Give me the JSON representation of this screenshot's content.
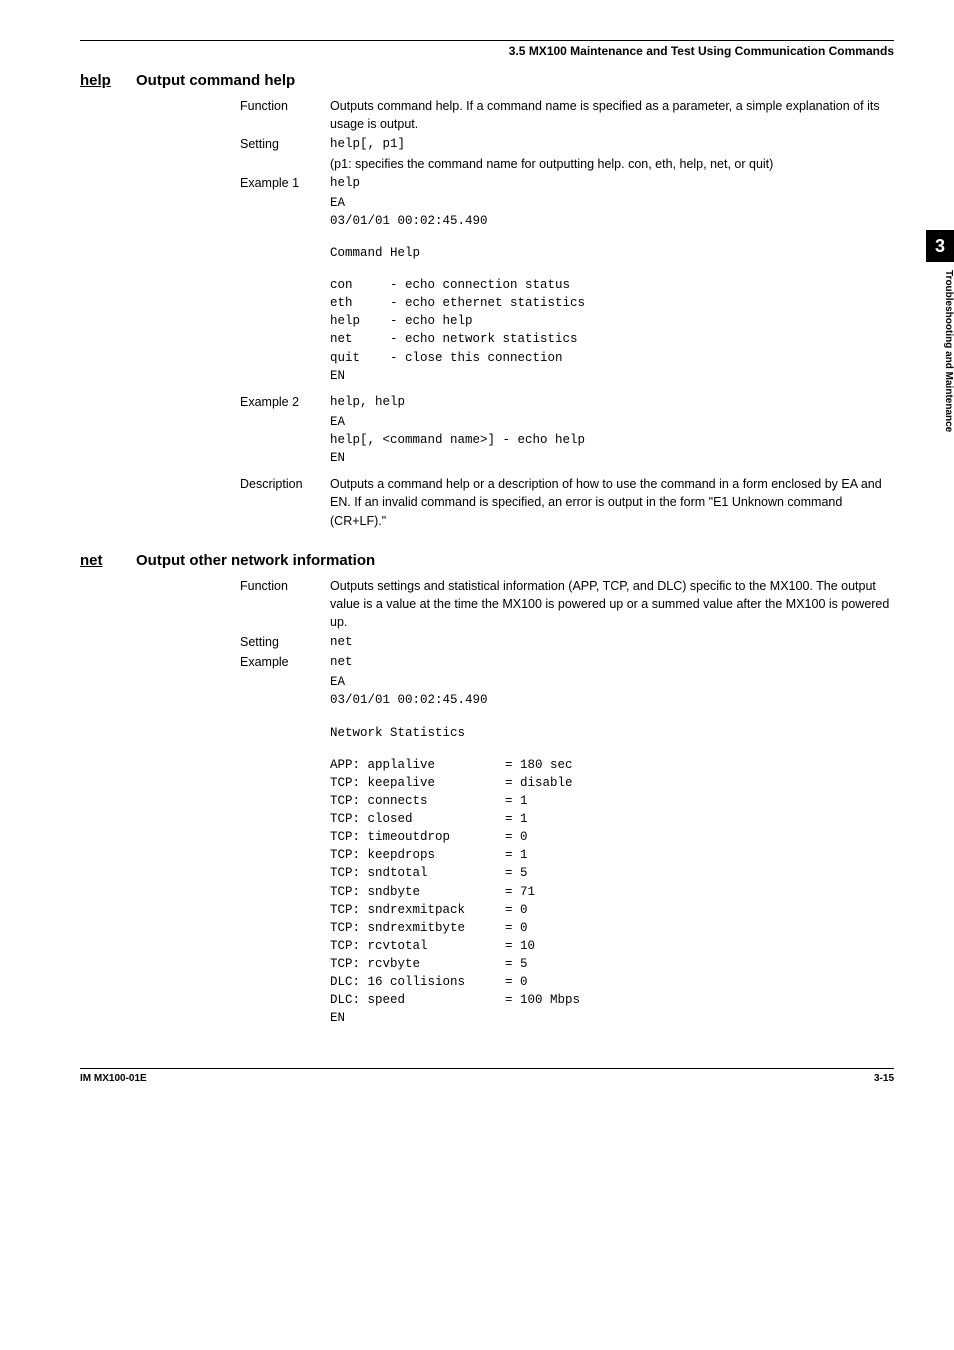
{
  "header": {
    "section_title": "3.5 MX100 Maintenance and Test Using Communication Commands"
  },
  "help_cmd": {
    "abbr": "help",
    "title": "Output command help",
    "function_label": "Function",
    "function_text": "Outputs command help. If a command name is specified as a parameter, a simple explanation of its usage is output.",
    "setting_label": "Setting",
    "setting_code": "help[, p1]",
    "setting_note": "(p1: specifies the command name for outputting help. con, eth, help, net, or quit)",
    "ex1_label": "Example 1",
    "ex1_line1": "help",
    "ex1_line2": "EA",
    "ex1_line3": "03/01/01 00:02:45.490",
    "ex1_header": "Command Help",
    "ex1_rows": [
      {
        "k": "con",
        "v": "- echo connection status"
      },
      {
        "k": "eth",
        "v": "- echo ethernet statistics"
      },
      {
        "k": "help",
        "v": "- echo help"
      },
      {
        "k": "net",
        "v": "- echo network statistics"
      },
      {
        "k": "quit",
        "v": "- close this connection"
      }
    ],
    "ex1_footer": "EN",
    "ex2_label": "Example 2",
    "ex2_line1": "help, help",
    "ex2_line2": "EA",
    "ex2_line3": "help[, <command name>] - echo help",
    "ex2_line4": "EN",
    "desc_label": "Description",
    "desc_text": "Outputs a command help or a description of how to use the command in a form enclosed by EA and EN. If an invalid command is specified, an error is output in the form \"E1 Unknown command (CR+LF).\""
  },
  "net_cmd": {
    "abbr": "net",
    "title": "Output other network information",
    "function_label": "Function",
    "function_text": "Outputs settings and statistical information (APP, TCP, and DLC) specific to the MX100. The output value is a value at the time the MX100 is powered up or a summed value after the MX100 is powered up.",
    "setting_label": "Setting",
    "setting_code": "net",
    "example_label": "Example",
    "ex_line1": "net",
    "ex_line2": "EA",
    "ex_line3": "03/01/01 00:02:45.490",
    "ex_header": "Network Statistics",
    "stats": [
      {
        "k": "APP: applalive",
        "v": "= 180 sec"
      },
      {
        "k": "TCP: keepalive",
        "v": "= disable"
      },
      {
        "k": "TCP: connects",
        "v": "= 1"
      },
      {
        "k": "TCP: closed",
        "v": "= 1"
      },
      {
        "k": "TCP: timeoutdrop",
        "v": "= 0"
      },
      {
        "k": "TCP: keepdrops",
        "v": "= 1"
      },
      {
        "k": "TCP: sndtotal",
        "v": "= 5"
      },
      {
        "k": "TCP: sndbyte",
        "v": "= 71"
      },
      {
        "k": "TCP: sndrexmitpack",
        "v": "= 0"
      },
      {
        "k": "TCP: sndrexmitbyte",
        "v": "= 0"
      },
      {
        "k": "TCP: rcvtotal",
        "v": "= 10"
      },
      {
        "k": "TCP: rcvbyte",
        "v": "= 5"
      },
      {
        "k": "DLC: 16 collisions",
        "v": "= 0"
      },
      {
        "k": "DLC: speed",
        "v": "= 100 Mbps"
      }
    ],
    "ex_footer": "EN"
  },
  "side": {
    "chapter": "3",
    "label": "Troubleshooting and Maintenance"
  },
  "footer": {
    "left": "IM MX100-01E",
    "right": "3-15"
  }
}
